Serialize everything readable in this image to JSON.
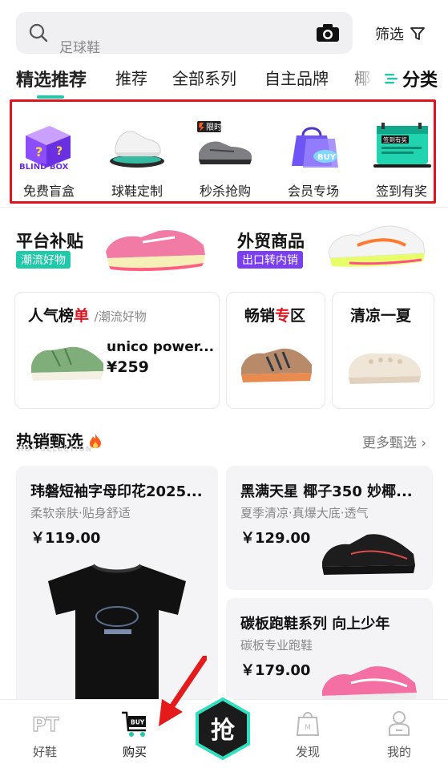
{
  "search": {
    "placeholder": "足球鞋",
    "filter_label": "筛选"
  },
  "tabs": [
    {
      "label": "精选推荐",
      "active": true
    },
    {
      "label": "推荐"
    },
    {
      "label": "全部系列"
    },
    {
      "label": "自主品牌"
    },
    {
      "label": "椰"
    }
  ],
  "category_label": "分类",
  "quick_entries": [
    {
      "label": "免费盲盒",
      "icon": "blind-box-icon",
      "badge": "BLIND BOX"
    },
    {
      "label": "球鞋定制",
      "icon": "custom-sneaker-icon"
    },
    {
      "label": "秒杀抢购",
      "icon": "flash-sale-icon",
      "badge": "限时"
    },
    {
      "label": "会员专场",
      "icon": "member-bag-icon",
      "badge": "BUY"
    },
    {
      "label": "签到有奖",
      "icon": "checkin-calendar-icon",
      "badge": "签到有奖"
    }
  ],
  "promos": [
    {
      "title": "平台补贴",
      "tag": "潮流好物"
    },
    {
      "title": "外贸商品",
      "tag": "出口转内销"
    }
  ],
  "cards": {
    "ranking": {
      "title_main": "人气榜",
      "title_accent": "单",
      "subtitle": "/潮流好物",
      "product_name": "unico power...",
      "price": "¥259"
    },
    "bestseller": {
      "title_main": "畅销",
      "title_accent": "专",
      "title_end": "区"
    },
    "cool": {
      "title": "清凉一夏"
    }
  },
  "hot": {
    "title": "热销甄选",
    "subtitle": "HOT SELECTION",
    "more_label": "更多甄选 ›",
    "products": [
      {
        "name": "玮磐短袖字母印花2025...",
        "desc": "柔软亲肤·贴身舒适",
        "price": "￥119.00"
      },
      {
        "name": "黑满天星 椰子350 妙椰...",
        "desc": "夏季清凉·真爆大底·透气",
        "price": "￥129.00"
      },
      {
        "name": "碳板跑鞋系列 向上少年",
        "desc": "碳板专业跑鞋",
        "price": "￥179.00"
      }
    ]
  },
  "nav": [
    {
      "label": "好鞋",
      "icon": "pt-icon"
    },
    {
      "label": "购买",
      "icon": "buy-cart-icon",
      "badge": "BUY"
    },
    {
      "label": "抢",
      "icon": "grab-icon"
    },
    {
      "label": "发现",
      "icon": "discover-bag-icon"
    },
    {
      "label": "我的",
      "icon": "profile-icon"
    }
  ],
  "colors": {
    "accent": "#1fc9a9",
    "highlight_border": "#e0141e",
    "tag_green": "#1fc9a9",
    "tag_purple": "#7b3ff2",
    "arrow_red": "#e51a1a"
  }
}
